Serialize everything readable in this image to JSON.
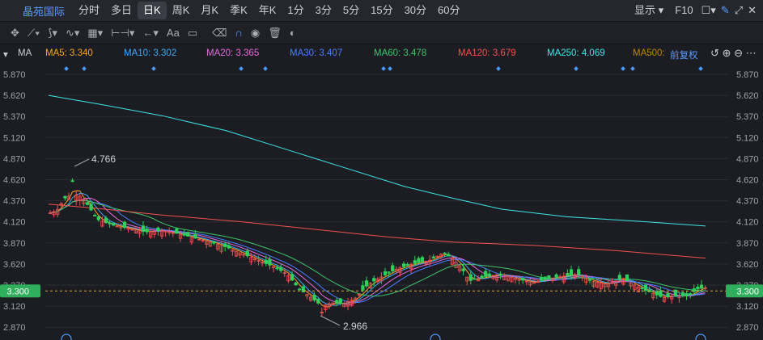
{
  "topbar": {
    "stock_name": "晶苑国际",
    "periods": [
      "分时",
      "多日",
      "日K",
      "周K",
      "月K",
      "季K",
      "年K",
      "1分",
      "3分",
      "5分",
      "15分",
      "30分",
      "60分"
    ],
    "active_period": "日K",
    "display_label": "显示",
    "f10_label": "F10"
  },
  "toolbar": {
    "text_tool_label": "Aa"
  },
  "ma_bar": {
    "indicator_label": "MA",
    "items": [
      {
        "label": "MA5: 3.340",
        "color": "#f5a623"
      },
      {
        "label": "MA10: 3.302",
        "color": "#3fa9f5"
      },
      {
        "label": "MA20: 3.365",
        "color": "#e86ae0"
      },
      {
        "label": "MA30: 3.407",
        "color": "#4a7dff"
      },
      {
        "label": "MA60: 3.478",
        "color": "#3fc26b"
      },
      {
        "label": "MA120: 3.679",
        "color": "#f0524f"
      },
      {
        "label": "MA250: 4.069",
        "color": "#3fe6e6"
      },
      {
        "label": "MA500:",
        "color": "#b8860b"
      }
    ],
    "adjust_label": "前复权"
  },
  "chart_data": {
    "type": "candlestick",
    "y_ticks": [
      "5.870",
      "5.620",
      "5.370",
      "5.120",
      "4.870",
      "4.620",
      "4.370",
      "4.120",
      "3.870",
      "3.620",
      "3.370",
      "3.120",
      "2.870"
    ],
    "ylim": [
      2.87,
      5.87
    ],
    "current_price": "3.300",
    "high_label": "4.766",
    "low_label": "2.966",
    "colors": {
      "up": "#f0524f",
      "down": "#2fd05b",
      "grid": "#2a2d33"
    }
  }
}
